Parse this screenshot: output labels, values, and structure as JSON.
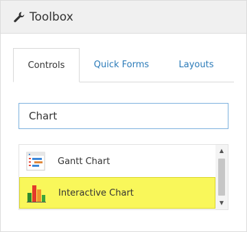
{
  "toolbox": {
    "title": "Toolbox",
    "header_icon": "wrench-icon"
  },
  "tabs": [
    {
      "label": "Controls",
      "active": true
    },
    {
      "label": "Quick Forms",
      "active": false
    },
    {
      "label": "Layouts",
      "active": false
    }
  ],
  "search": {
    "value": "Chart"
  },
  "results": [
    {
      "label": "Gantt Chart",
      "icon": "gantt-chart-icon",
      "selected": false
    },
    {
      "label": "Interactive Chart",
      "icon": "bar-chart-icon",
      "selected": true
    }
  ],
  "colors": {
    "accent_link": "#2a7ab8",
    "search_border": "#7bb0de",
    "selection_highlight": "#f9f75a"
  }
}
